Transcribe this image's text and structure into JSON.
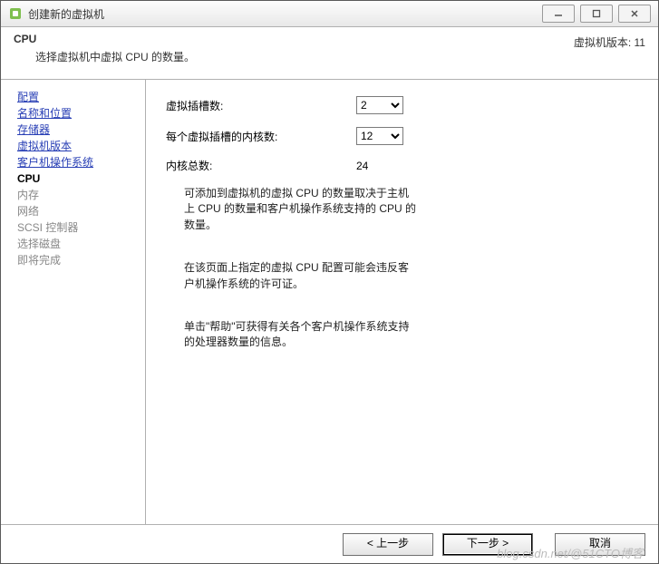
{
  "window": {
    "title": "创建新的虚拟机"
  },
  "header": {
    "title": "CPU",
    "subtitle": "选择虚拟机中虚拟 CPU 的数量。",
    "vm_version_label": "虚拟机版本: 11"
  },
  "sidebar": {
    "items": [
      {
        "label": "配置",
        "state": "visited"
      },
      {
        "label": "名称和位置",
        "state": "visited"
      },
      {
        "label": "存储器",
        "state": "visited"
      },
      {
        "label": "虚拟机版本",
        "state": "visited"
      },
      {
        "label": "客户机操作系统",
        "state": "visited"
      },
      {
        "label": "CPU",
        "state": "current"
      },
      {
        "label": "内存",
        "state": "future"
      },
      {
        "label": "网络",
        "state": "future"
      },
      {
        "label": "SCSI 控制器",
        "state": "future"
      },
      {
        "label": "选择磁盘",
        "state": "future"
      },
      {
        "label": "即将完成",
        "state": "future"
      }
    ]
  },
  "content": {
    "sockets_label": "虚拟插槽数:",
    "sockets_value": "2",
    "cores_label": "每个虚拟插槽的内核数:",
    "cores_value": "12",
    "total_label": "内核总数:",
    "total_value": "24",
    "info1": "可添加到虚拟机的虚拟 CPU 的数量取决于主机上 CPU 的数量和客户机操作系统支持的 CPU 的数量。",
    "info2": "在该页面上指定的虚拟 CPU 配置可能会违反客户机操作系统的许可证。",
    "info3": "单击\"帮助\"可获得有关各个客户机操作系统支持的处理器数量的信息。"
  },
  "footer": {
    "back": "< 上一步",
    "next": "下一步 >",
    "cancel": "取消"
  },
  "watermark": "blog.csdn.net/@51CTO博客"
}
